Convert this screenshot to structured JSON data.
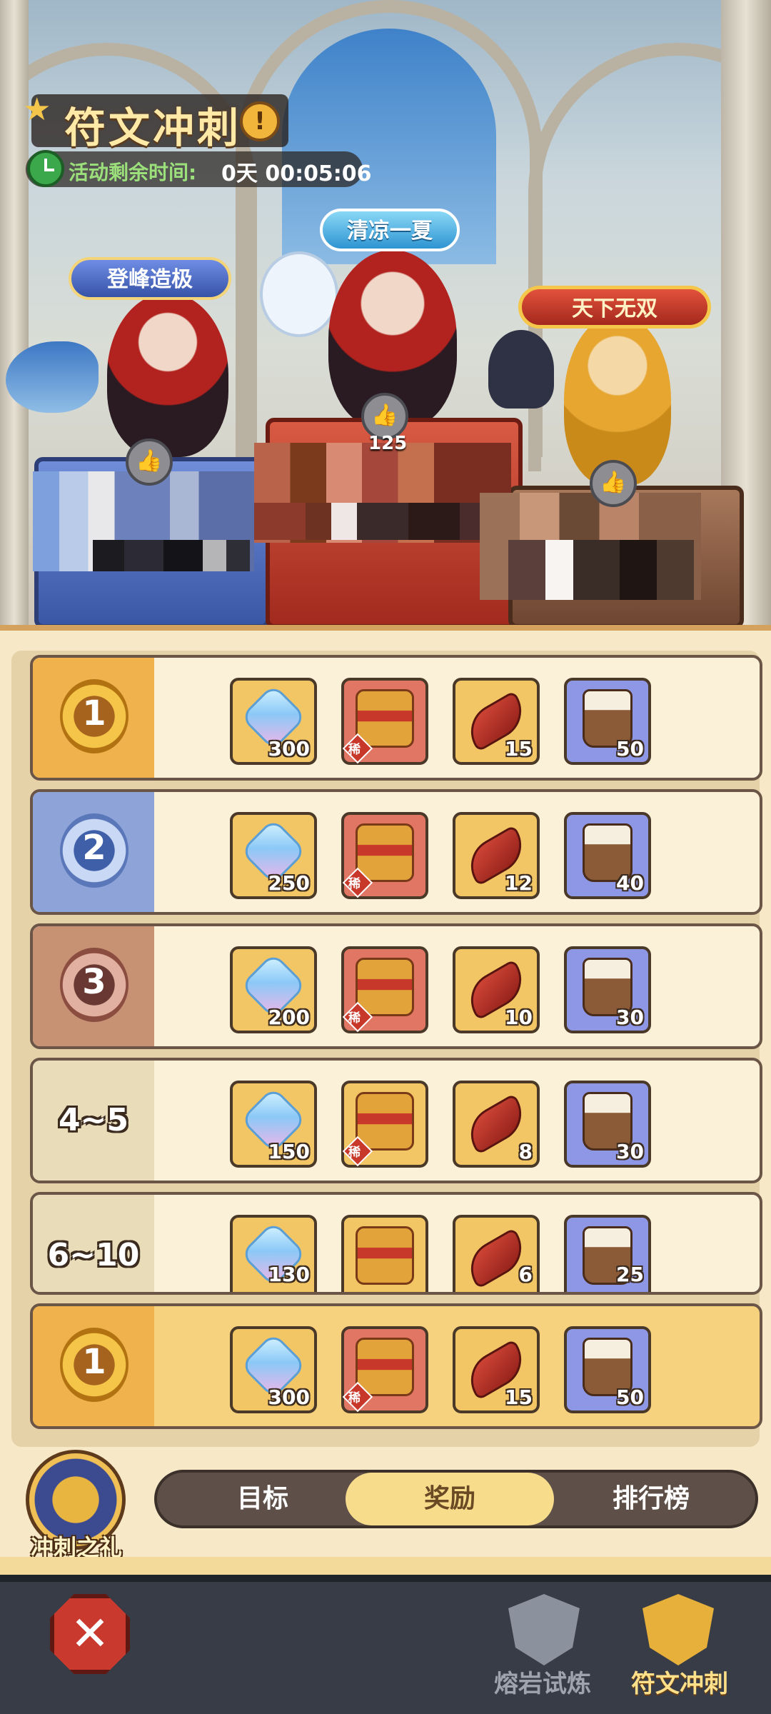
{
  "header": {
    "title": "符文冲刺",
    "timer_label": "活动剩余时间:",
    "timer_value": "0天 00:05:06"
  },
  "podium": {
    "left_banner": "登峰造极",
    "center_banner": "清凉一夏",
    "right_banner": "天下无双",
    "center_likes": "125"
  },
  "rewards": {
    "rows": [
      {
        "rank": "1",
        "crystal": "300",
        "chest_tag": "稀",
        "scroll": "15",
        "mug": "50"
      },
      {
        "rank": "2",
        "crystal": "250",
        "chest_tag": "稀",
        "scroll": "12",
        "mug": "40"
      },
      {
        "rank": "3",
        "crystal": "200",
        "chest_tag": "稀",
        "scroll": "10",
        "mug": "30"
      },
      {
        "rank": "4~5",
        "crystal": "150",
        "chest_tag": "稀",
        "scroll": "8",
        "mug": "30"
      },
      {
        "rank": "6~10",
        "crystal": "130",
        "scroll": "6",
        "mug": "25"
      },
      {
        "rank": "1",
        "crystal": "300",
        "chest_tag": "稀",
        "scroll": "15",
        "mug": "50"
      }
    ]
  },
  "tabs": {
    "gift_label": "冲刺之礼",
    "items": [
      "目标",
      "奖励",
      "排行榜"
    ],
    "active": "奖励"
  },
  "bottom_nav": {
    "items": [
      "熔岩试炼",
      "符文冲刺"
    ],
    "active": "符文冲刺"
  },
  "colors": {
    "accent_gold": "#f0b24c",
    "silver": "#8ea4d9",
    "bronze": "#c79274",
    "active_tab": "#f7dc8c",
    "nav_bg": "#373c47"
  }
}
